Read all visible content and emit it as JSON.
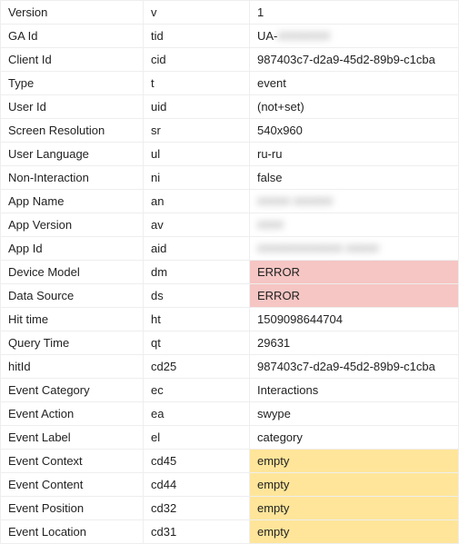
{
  "rows": [
    {
      "label": "Version",
      "param": "v",
      "value": "1",
      "state": ""
    },
    {
      "label": "GA Id",
      "param": "tid",
      "value": "UA-",
      "state": "",
      "blur": "########"
    },
    {
      "label": "Client Id",
      "param": "cid",
      "value": "987403c7-d2a9-45d2-89b9-c1cba",
      "state": ""
    },
    {
      "label": "Type",
      "param": "t",
      "value": "event",
      "state": ""
    },
    {
      "label": "User Id",
      "param": "uid",
      "value": "(not+set)",
      "state": ""
    },
    {
      "label": "Screen Resolution",
      "param": "sr",
      "value": "540x960",
      "state": ""
    },
    {
      "label": "User Language",
      "param": "ul",
      "value": "ru-ru",
      "state": ""
    },
    {
      "label": "Non-Interaction",
      "param": "ni",
      "value": "false",
      "state": ""
    },
    {
      "label": "App Name",
      "param": "an",
      "value": "",
      "state": "",
      "blur": "##### ######"
    },
    {
      "label": "App Version",
      "param": "av",
      "value": "",
      "state": "",
      "blur": "####"
    },
    {
      "label": "App Id",
      "param": "aid",
      "value": "",
      "state": "",
      "blur": "############# #####"
    },
    {
      "label": "Device Model",
      "param": "dm",
      "value": "ERROR",
      "state": "error"
    },
    {
      "label": "Data Source",
      "param": "ds",
      "value": "ERROR",
      "state": "error"
    },
    {
      "label": "Hit time",
      "param": "ht",
      "value": "1509098644704",
      "state": ""
    },
    {
      "label": "Query Time",
      "param": "qt",
      "value": "29631",
      "state": ""
    },
    {
      "label": "hitId",
      "param": "cd25",
      "value": "987403c7-d2a9-45d2-89b9-c1cba",
      "state": ""
    },
    {
      "label": "Event Category",
      "param": "ec",
      "value": "Interactions",
      "state": ""
    },
    {
      "label": "Event Action",
      "param": "ea",
      "value": "swype",
      "state": ""
    },
    {
      "label": "Event Label",
      "param": "el",
      "value": "category",
      "state": ""
    },
    {
      "label": "Event Context",
      "param": "cd45",
      "value": "empty",
      "state": "warning"
    },
    {
      "label": "Event Content",
      "param": "cd44",
      "value": "empty",
      "state": "warning"
    },
    {
      "label": "Event Position",
      "param": "cd32",
      "value": "empty",
      "state": "warning"
    },
    {
      "label": "Event Location",
      "param": "cd31",
      "value": "empty",
      "state": "warning"
    }
  ]
}
